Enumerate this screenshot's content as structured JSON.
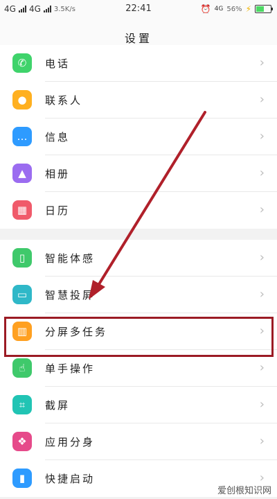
{
  "status": {
    "network_left": "4G",
    "network_right": "4G",
    "speed": "3.5K/s",
    "time": "22:41",
    "alarm_icon": "alarm-icon",
    "net_badge": "4G",
    "battery_percent": "56%",
    "battery_level": 0.56,
    "charging_icon": "charging-icon"
  },
  "header": {
    "title": "设置"
  },
  "groups": [
    {
      "items": [
        {
          "label": "电话",
          "icon": "phone-icon",
          "color": "#3fd36b",
          "glyph": "✆"
        },
        {
          "label": "联系人",
          "icon": "contacts-icon",
          "color": "#ffb020",
          "glyph": "●"
        },
        {
          "label": "信息",
          "icon": "message-icon",
          "color": "#2e9bff",
          "glyph": "…"
        },
        {
          "label": "相册",
          "icon": "album-icon",
          "color": "#9b6cf0",
          "glyph": "▲"
        },
        {
          "label": "日历",
          "icon": "calendar-icon",
          "color": "#f05a6a",
          "glyph": "▦"
        }
      ]
    },
    {
      "items": [
        {
          "label": "智能体感",
          "icon": "motion-icon",
          "color": "#3fc96b",
          "glyph": "▯"
        },
        {
          "label": "智慧投屏",
          "icon": "screencast-icon",
          "color": "#2fb8c8",
          "glyph": "▭"
        },
        {
          "label": "分屏多任务",
          "icon": "splitscreen-icon",
          "color": "#ffa020",
          "glyph": "▥"
        },
        {
          "label": "单手操作",
          "icon": "onehand-icon",
          "color": "#3fc96b",
          "glyph": "☝"
        },
        {
          "label": "截屏",
          "icon": "screenshot-icon",
          "color": "#21c4b4",
          "glyph": "⌗"
        },
        {
          "label": "应用分身",
          "icon": "appclone-icon",
          "color": "#e64a8a",
          "glyph": "❖"
        },
        {
          "label": "快捷启动",
          "icon": "quicklaunch-icon",
          "color": "#2e9bff",
          "glyph": "▮"
        }
      ]
    }
  ],
  "chevron": "›",
  "watermark": "爱创根知识网"
}
